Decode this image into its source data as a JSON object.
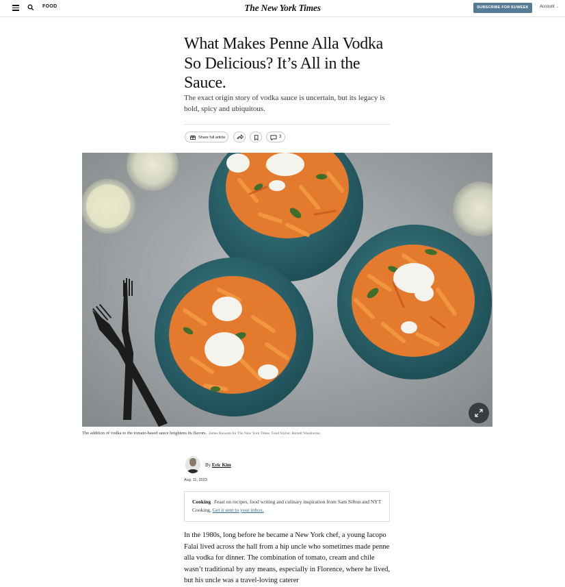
{
  "header": {
    "section": "FOOD",
    "logo": "The New York Times",
    "subscribe": "SUBSCRIBE FOR $1/WEEK",
    "account": "Account"
  },
  "article": {
    "headline": "What Makes Penne Alla Vodka So Delicious? It’s All in the Sauce.",
    "summary": "The exact origin story of vodka sauce is uncertain, but its legacy is bold, spicy and ubiquitous.",
    "share_label": "Share full article",
    "comment_count": "3",
    "caption": "The addition of vodka to the tomato-based sauce heightens its flavors.",
    "credit": "James Ransom for The New York Times. Food Stylist: Barrett Washburne.",
    "byline_prefix": "By",
    "author": "Eric Kim",
    "date": "Aug. 11, 2023",
    "body": "In the 1980s, long before he became a New York chef, a young Iacopo Falai lived across the hall from a hip uncle who sometimes made penne alla vodka for dinner. The combination of tomato, cream and chile wasn’t traditional by any means, especially in Florence, where he lived, but his uncle was a travel-loving caterer"
  },
  "promo": {
    "title": "Cooking",
    "text": "Feast on recipes, food writing and culinary inspiration from Sam Sifton and NYT Cooking.",
    "link": "Get it sent to your inbox."
  },
  "colors": {
    "subscribe_bg": "#567b95",
    "link": "#326891",
    "plate": "#2f6b74",
    "sauce": "#e37a2e"
  }
}
